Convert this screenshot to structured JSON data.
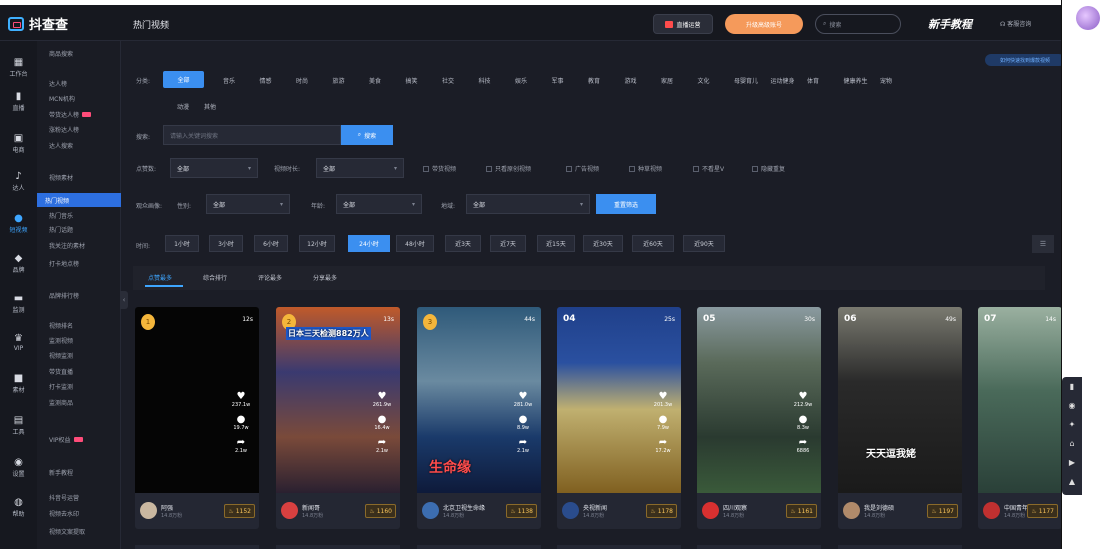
{
  "app": {
    "name": "抖查查",
    "page_title": "热门视频"
  },
  "topbar": {
    "live_btn": "直播运营",
    "promo_btn": "升级高级账号",
    "search_placeholder": "搜索",
    "guide": "新手教程",
    "help": "客服咨询"
  },
  "iconbar": [
    {
      "glyph": "▦",
      "label": "工作台",
      "icon": "dashboard-icon"
    },
    {
      "glyph": "▮",
      "label": "直播",
      "icon": "live-icon"
    },
    {
      "glyph": "▣",
      "label": "电商",
      "icon": "shop-icon"
    },
    {
      "glyph": "♪",
      "label": "达人",
      "icon": "tiktok-icon"
    },
    {
      "glyph": "●",
      "label": "短视频",
      "icon": "video-icon"
    },
    {
      "glyph": "◆",
      "label": "品牌",
      "icon": "brand-icon"
    },
    {
      "glyph": "▬",
      "label": "监测",
      "icon": "monitor-icon"
    },
    {
      "glyph": "♛",
      "label": "VIP",
      "icon": "vip-icon"
    },
    {
      "glyph": "■",
      "label": "素材",
      "icon": "material-icon"
    },
    {
      "glyph": "▤",
      "label": "工具",
      "icon": "tool-icon"
    },
    {
      "glyph": "◉",
      "label": "设置",
      "icon": "settings-icon"
    },
    {
      "glyph": "◍",
      "label": "帮助",
      "icon": "help-icon"
    }
  ],
  "menu": [
    "商品搜索",
    "达人榜",
    "MCN机构",
    "带货达人榜",
    "涨粉达人榜",
    "达人搜索",
    "视频素材",
    "热门视频",
    "热门音乐",
    "热门话题",
    "我关注的素材",
    "打卡地点榜",
    "品牌排行榜",
    "视频排名",
    "监测视频",
    "视频监测",
    "带货直播",
    "打卡监测",
    "监测商品",
    "VIP权益",
    "新手教程",
    "抖音号运营",
    "视频去水印",
    "视频文案提取"
  ],
  "filters": {
    "category_label": "分类:",
    "categories": [
      "全部",
      "音乐",
      "情感",
      "时尚",
      "旅游",
      "美食",
      "搞笑",
      "社交",
      "科技",
      "娱乐",
      "军事",
      "教育",
      "游戏",
      "家居",
      "文化",
      "母婴育儿",
      "运动健身",
      "体育",
      "健康养生",
      "宠物",
      "动漫",
      "其他"
    ],
    "keyword_label": "搜索:",
    "keyword_placeholder": "请输入关键词搜索",
    "search_btn": "搜索",
    "video_type_label": "点赞数:",
    "video_type_value": "全部",
    "duration_label": "视频时长:",
    "duration_value": "全部",
    "checkboxes": [
      "带货视频",
      "只看原创视频",
      "广告视频",
      "种草视频",
      "不看星V",
      "隐藏重复"
    ],
    "audience_label": "观众画像:",
    "gender_label": "性别:",
    "gender_value": "全部",
    "age_label": "年龄:",
    "age_value": "全部",
    "region_label": "地域:",
    "region_value": "全部",
    "reset_btn": "重置筛选",
    "time_label": "时间:",
    "time_chips": [
      "1小时",
      "3小时",
      "6小时",
      "12小时",
      "24小时",
      "48小时",
      "近3天",
      "近7天",
      "近15天",
      "近30天",
      "近60天",
      "近90天"
    ],
    "time_selected": "24小时"
  },
  "corner_link": "如何快速找到爆款视频",
  "tabs": [
    "点赞最多",
    "综合排行",
    "评论最多",
    "分享最多"
  ],
  "cards": [
    {
      "rank": "1",
      "duration": "12s",
      "likes": "237.1w",
      "comments": "19.7w",
      "shares": "2.1w",
      "author": "阿强",
      "fans": "14.8万粉",
      "hot": "1152",
      "bg": "#050505",
      "avbg": "#c9b7a0",
      "caption": ""
    },
    {
      "rank": "2",
      "duration": "13s",
      "likes": "261.9w",
      "comments": "16.4w",
      "shares": "2.1w",
      "author": "新闻哥",
      "fans": "14.8万粉",
      "hot": "1160",
      "bg": "#8a3a2a",
      "avbg": "#d84040",
      "caption": "日本三天检测882万人"
    },
    {
      "rank": "3",
      "duration": "44s",
      "likes": "281.0w",
      "comments": "8.9w",
      "shares": "2.1w",
      "author": "北京卫视生命缘",
      "fans": "14.8万粉",
      "hot": "1138",
      "bg": "#2b3f5a",
      "avbg": "#3c6db0",
      "caption": "生命缘"
    },
    {
      "rank": "04",
      "duration": "25s",
      "likes": "201.3w",
      "comments": "7.9w",
      "shares": "17.2w",
      "author": "央视新闻",
      "fans": "14.8万粉",
      "hot": "1178",
      "bg": "#6a6a30",
      "avbg": "#2a4c8c",
      "caption": ""
    },
    {
      "rank": "05",
      "duration": "30s",
      "likes": "212.9w",
      "comments": "8.3w",
      "shares": "6886",
      "author": "四川观察",
      "fans": "14.8万粉",
      "hot": "1161",
      "bg": "#3a4a3a",
      "avbg": "#d83030",
      "caption": ""
    },
    {
      "rank": "06",
      "duration": "49s",
      "likes": "",
      "comments": "",
      "shares": "",
      "author": "我是刘德硕",
      "fans": "14.8万粉",
      "hot": "1197",
      "bg": "#4a4a48",
      "avbg": "#b08a6a",
      "caption": "天天逗我姥"
    },
    {
      "rank": "07",
      "duration": "14s",
      "likes": "",
      "comments": "",
      "shares": "",
      "author": "中国青年报",
      "fans": "14.8万粉",
      "hot": "1177",
      "bg": "#4b6a5a",
      "avbg": "#c03030",
      "caption": ""
    }
  ]
}
